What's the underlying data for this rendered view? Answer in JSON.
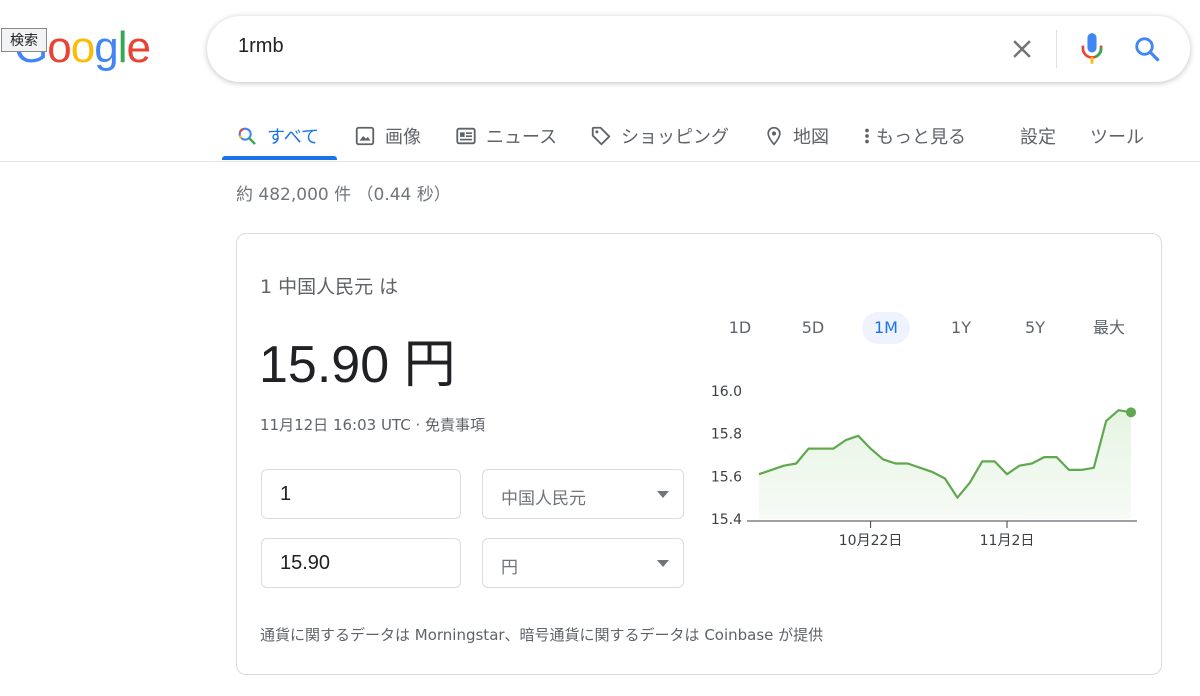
{
  "tooltip": "検索",
  "logo": {
    "letters": [
      "G",
      "o",
      "o",
      "g",
      "l",
      "e"
    ]
  },
  "search": {
    "query": "1rmb"
  },
  "icons": {
    "clear": "close-icon",
    "mic": "microphone-icon",
    "search": "search-icon",
    "colors": {
      "blue": "#4285F4",
      "red": "#EA4335",
      "yellow": "#FBBC05",
      "green": "#34A853"
    }
  },
  "tabs": [
    {
      "label": "すべて",
      "icon": "search-icon",
      "active": true
    },
    {
      "label": "画像",
      "icon": "image-icon"
    },
    {
      "label": "ニュース",
      "icon": "news-icon"
    },
    {
      "label": "ショッピング",
      "icon": "tag-icon"
    },
    {
      "label": "地図",
      "icon": "map-pin-icon"
    },
    {
      "label": "もっと見る",
      "icon": "more-vert-icon"
    },
    {
      "label": "設定"
    },
    {
      "label": "ツール"
    }
  ],
  "result_stats": "約 482,000 件 （0.44 秒）",
  "converter": {
    "label": "1 中国人民元 は",
    "value": "15.90 円",
    "timestamp": "11月12日 16:03 UTC · 免責事項",
    "from_amount": "1",
    "from_currency": "中国人民元",
    "to_amount": "15.90",
    "to_currency": "円",
    "footer": "通貨に関するデータは Morningstar、暗号通貨に関するデータは Coinbase が提供"
  },
  "ranges": [
    {
      "label": "1D"
    },
    {
      "label": "5D"
    },
    {
      "label": "1M",
      "active": true
    },
    {
      "label": "1Y"
    },
    {
      "label": "5Y"
    },
    {
      "label": "最大"
    }
  ],
  "accent_color": "#1a73e8",
  "chart_data": {
    "type": "area",
    "title": "",
    "xlabel": "",
    "ylabel": "",
    "ylim": [
      15.4,
      16.0
    ],
    "y_ticks": [
      "16.0",
      "15.8",
      "15.6",
      "15.4"
    ],
    "x_ticks": [
      {
        "label": "10月22日",
        "index": 9
      },
      {
        "label": "11月2日",
        "index": 20
      }
    ],
    "series": [
      {
        "values": [
          15.61,
          15.63,
          15.65,
          15.66,
          15.73,
          15.73,
          15.73,
          15.77,
          15.79,
          15.73,
          15.68,
          15.66,
          15.66,
          15.64,
          15.62,
          15.59,
          15.5,
          15.57,
          15.67,
          15.67,
          15.61,
          15.65,
          15.66,
          15.69,
          15.69,
          15.63,
          15.63,
          15.64,
          15.86,
          15.91,
          15.9
        ]
      }
    ],
    "line_color": "#5fa84e",
    "fill_color": "#e6f4e3",
    "grid": false,
    "legend": "none"
  }
}
